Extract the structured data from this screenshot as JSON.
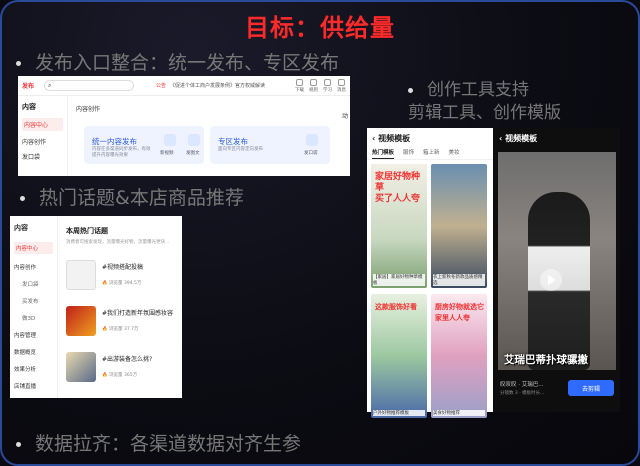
{
  "title": "目标：供给量",
  "bullets": {
    "b1": "发布入口整合：统一发布、专区发布",
    "b2": "热门话题&本店商品推荐",
    "b3_line1": "创作工具支持",
    "b3_line2": "剪辑工具、创作模版",
    "b4": "数据拉齐：各渠道数据对齐生参"
  },
  "panel1": {
    "logo": "发布",
    "notice_label": "公告",
    "notice_text": "《促进个体工商户发展条例》官方权威解读",
    "toolbar": [
      "下载",
      "规则",
      "学习",
      "消息"
    ],
    "side_title": "内容",
    "side_items": [
      "内容中心",
      "内容创作",
      "发口袋"
    ],
    "main_title": "内容创作",
    "card1_title": "统一内容发布",
    "card1_sub": "内容在多渠道同步发布，有效提升内容曝光效果",
    "card1_icons": [
      "新视频",
      "发图文"
    ],
    "card2_title": "专区发布",
    "card2_sub": "面向专区内容定向发布",
    "card2_icon": "发口袋",
    "edge_label": "动"
  },
  "panel2": {
    "side_title": "内容",
    "side_items": [
      "内容中心",
      "内容创作",
      "发口袋",
      "买发布",
      "做3D",
      "内容管理",
      "数据概览",
      "效果分析",
      "店铺直播"
    ],
    "main_title": "本周热门话题",
    "main_desc": "消费者可搜索发现，流量曝光好物，流量曝光更快...",
    "rows": [
      {
        "title": "#视频搭配投稿",
        "views_label": "浏览量",
        "views": "394.5万"
      },
      {
        "title": "#我们打造新年氛围感妆容",
        "views_label": "浏览量",
        "views": "37.7万"
      },
      {
        "title": "#出游装备怎么挑?",
        "views_label": "浏览量",
        "views": "365万"
      }
    ]
  },
  "panel3": {
    "header": "视频模板",
    "tabs": [
      "热门模板",
      "服饰",
      "箱上新",
      "美妆"
    ],
    "tiles": [
      {
        "big": "家居好物种草\n买了人人夸",
        "cap": "【家居】家居好物种草模板"
      },
      {
        "big": "",
        "cap": "衣上新秋冬新款品质感精选"
      },
      {
        "big": "这款服饰好看",
        "cap": "户外好物推荐模板"
      },
      {
        "big": "厨房好物就选它\n家里人人夸",
        "cap": "美食好物推荐"
      }
    ]
  },
  "panel4": {
    "header": "视频模板",
    "subtitle": "艾瑞巴蒂扑球骡撇",
    "footer_title": "叹叹叹 · 艾瑞巴...",
    "footer_sub": "分镜数 3 · 模板时长...",
    "button": "去剪辑"
  }
}
